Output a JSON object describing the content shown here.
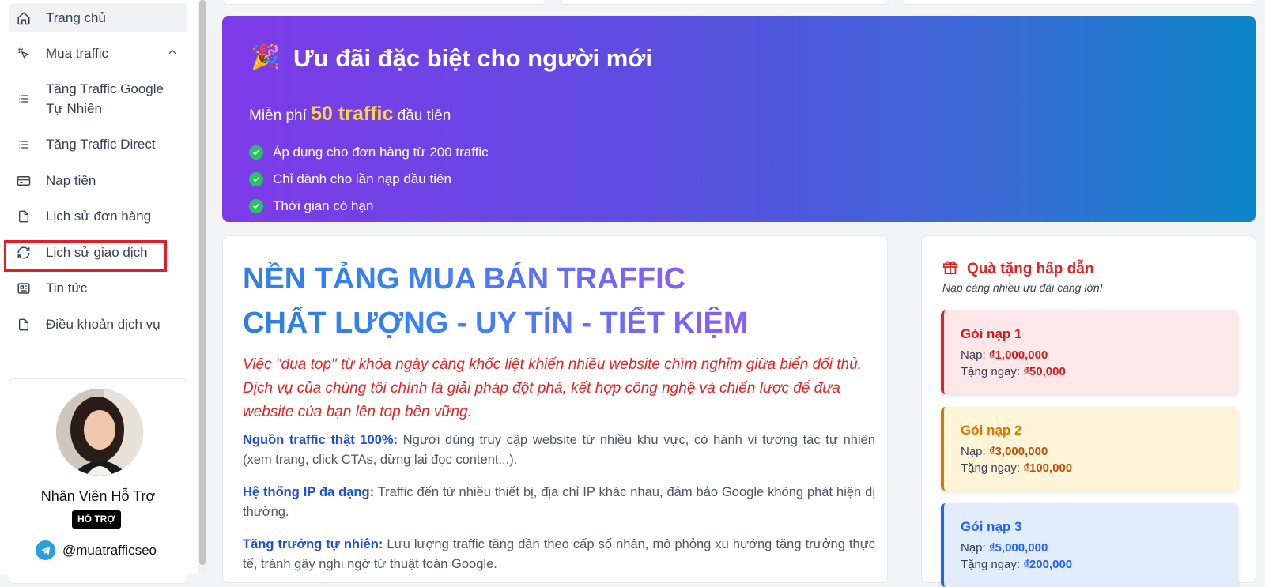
{
  "sidebar": {
    "items": [
      {
        "label": "Trang chủ",
        "icon": "home-icon"
      },
      {
        "label": "Mua traffic",
        "icon": "cursor-click-icon"
      },
      {
        "label": "Tăng Traffic Google",
        "label2": "Tự Nhiên",
        "icon": "list-icon"
      },
      {
        "label": "Tăng Traffic Direct",
        "icon": "list-icon"
      },
      {
        "label": "Nạp tiền",
        "icon": "credit-card-icon"
      },
      {
        "label": "Lịch sử đơn hàng",
        "icon": "file-icon"
      },
      {
        "label": "Lịch sử giao dịch",
        "icon": "refresh-icon"
      },
      {
        "label": "Tin tức",
        "icon": "newspaper-icon"
      },
      {
        "label": "Điều khoản dịch vụ",
        "icon": "file-icon"
      }
    ]
  },
  "support": {
    "name": "Nhân Viên Hỗ Trợ",
    "badge": "HỖ TRỢ",
    "telegram": "@muatrafficseo"
  },
  "promo": {
    "title": "Ưu đãi đặc biệt cho người mới",
    "sub_prefix": "Miễn phí",
    "sub_highlight": "50 traffic",
    "sub_suffix": "đầu tiên",
    "bullets": [
      "Áp dụng cho đơn hàng từ 200 traffic",
      "Chỉ dành cho lần nạp đầu tiên",
      "Thời gian có hạn"
    ]
  },
  "main": {
    "hero_line1": "NỀN TẢNG MUA BÁN TRAFFIC",
    "hero_line2": "CHẤT LƯỢNG - UY TÍN - TIẾT KIỆM",
    "lead": "Việc \"đua top\" từ khóa ngày càng khốc liệt khiến nhiều website chìm nghỉm giữa biển đối thủ. Dịch vụ của chúng tôi chính là giải pháp đột phá, kết hợp công nghệ và chiến lược để đưa website của bạn lên top bền vững.",
    "paras": [
      {
        "head": "Nguồn traffic thật 100%:",
        "body": " Người dùng truy cập website từ nhiều khu vực, có hành vi tương tác tự nhiên (xem trang, click CTAs, dừng lại đọc content...)."
      },
      {
        "head": "Hệ thống IP đa dạng:",
        "body": " Traffic đến từ nhiều thiết bị, địa chỉ IP khác nhau, đảm bảo Google không phát hiện dị thường."
      },
      {
        "head": "Tăng trưởng tự nhiên:",
        "body": " Lưu lượng traffic tăng dần theo cấp số nhân, mô phỏng xu hướng tăng trưởng thực tế, tránh gây nghi ngờ từ thuật toán Google."
      }
    ]
  },
  "gifts": {
    "title": "Quà tặng hấp dẫn",
    "subtitle": "Nạp càng nhiều ưu đãi càng lớn!",
    "deposit_label": "Nạp:",
    "bonus_label": "Tặng ngay:",
    "packages": [
      {
        "name": "Gói nạp 1",
        "deposit": "₫1,000,000",
        "bonus": "₫50,000"
      },
      {
        "name": "Gói nạp 2",
        "deposit": "₫3,000,000",
        "bonus": "₫100,000"
      },
      {
        "name": "Gói nạp 3",
        "deposit": "₫5,000,000",
        "bonus": "₫200,000"
      }
    ]
  }
}
